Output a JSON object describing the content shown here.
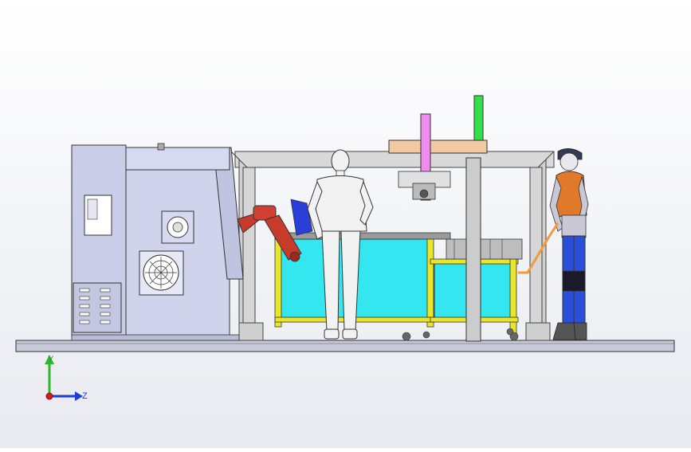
{
  "axes_triad": {
    "y_label": "Y",
    "z_label": "Z",
    "colors": {
      "y_axis": "#2fb52f",
      "z_axis": "#1a3fd8",
      "origin": "#d81a1a"
    }
  },
  "colors": {
    "background_top": "#ffffff",
    "background_bottom": "#e8eaf0",
    "machine": "#c9cde8",
    "frame": "#d8d8d8",
    "robot_arm": "#c83a2a",
    "table_fill": "#33e6f0",
    "table_frame": "#e9e62a",
    "gantry_beam": "#f2c9a0",
    "magenta_column": "#f08cf0",
    "green_column": "#33e04a",
    "hose": "#f29a3a",
    "worker_jacket": "#e07a2a",
    "worker_pants": "#2a4fd8",
    "mannequin": "#f2f2f2"
  }
}
